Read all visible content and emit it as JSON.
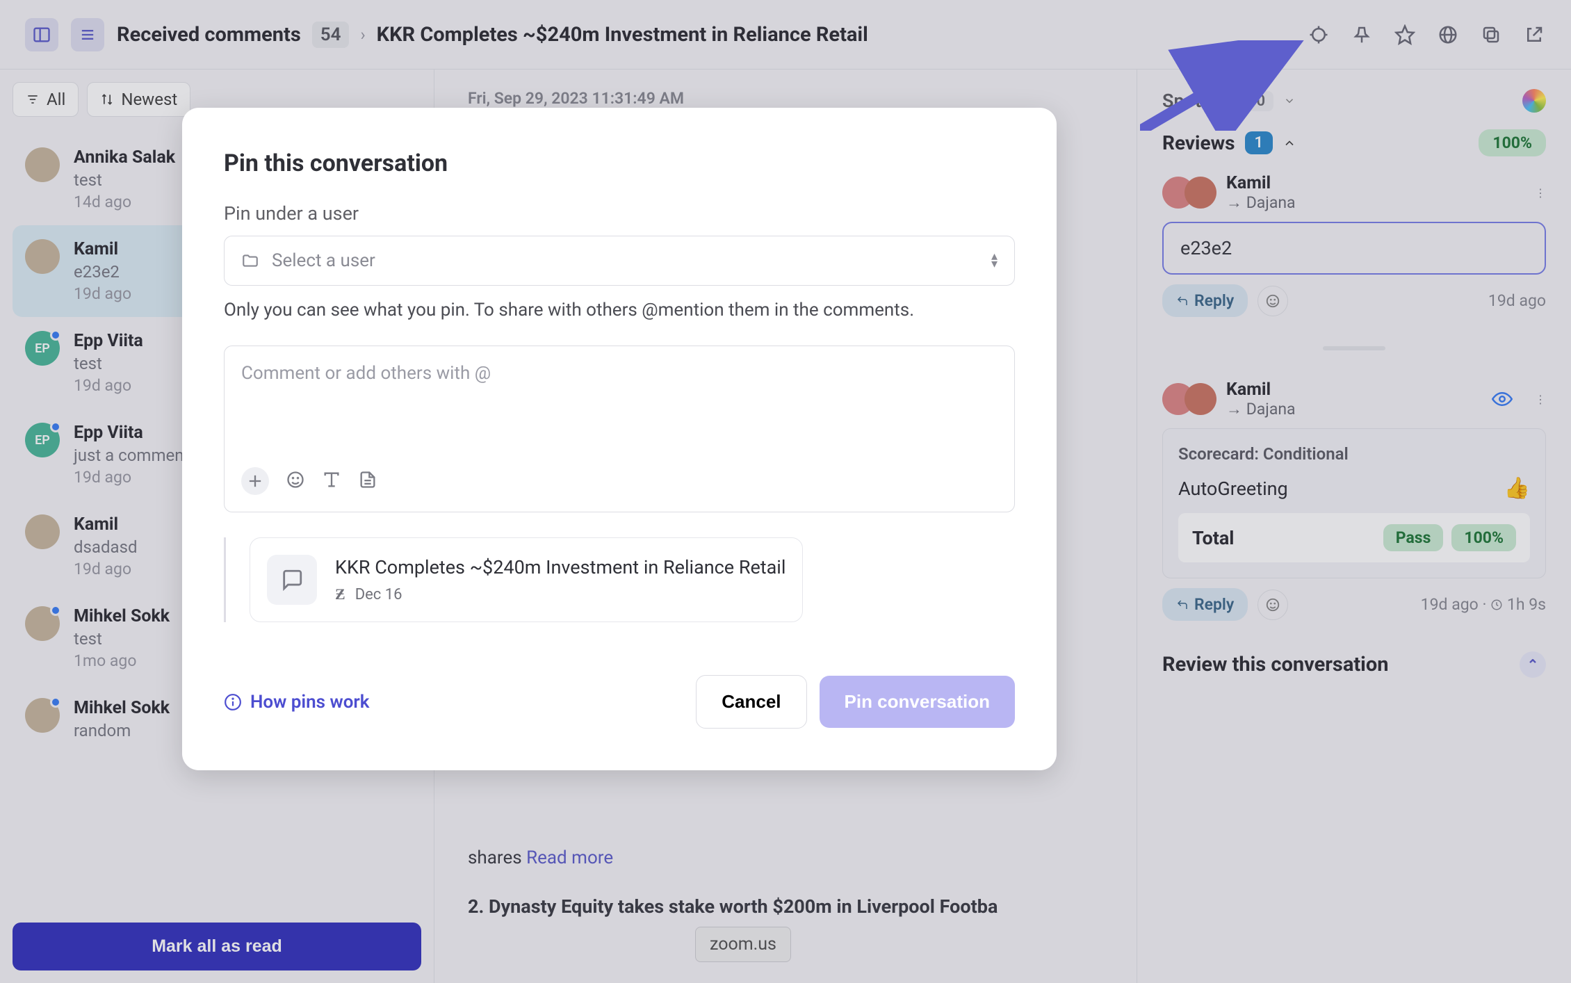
{
  "header": {
    "crumb_label": "Received comments",
    "crumb_count": "54",
    "title": "KKR Completes ~$240m Investment in Reliance Retail"
  },
  "filters": {
    "all": "All",
    "sort": "Newest"
  },
  "conversations": [
    {
      "name": "Annika Salak",
      "snippet": "test",
      "time": "14d ago",
      "avatar": "photo",
      "dot": false
    },
    {
      "name": "Kamil",
      "snippet": "e23e2",
      "time": "19d ago",
      "avatar": "photo",
      "dot": false,
      "active": true
    },
    {
      "name": "Epp Viita",
      "snippet": "test",
      "time": "19d ago",
      "avatar": "ep",
      "dot": true
    },
    {
      "name": "Epp Viita",
      "snippet": "just a commen",
      "time": "19d ago",
      "avatar": "ep",
      "dot": true
    },
    {
      "name": "Kamil",
      "snippet": "dsadasd",
      "time": "19d ago",
      "avatar": "photo",
      "dot": false
    },
    {
      "name": "Mihkel Sokk",
      "snippet": "test",
      "time": "1mo ago",
      "avatar": "photo",
      "dot": true
    },
    {
      "name": "Mihkel Sokk",
      "snippet": "random",
      "time": "",
      "avatar": "photo",
      "dot": true
    }
  ],
  "mark_read": "Mark all as read",
  "mid": {
    "timestamp": "Fri, Sep 29, 2023 11:31:49 AM",
    "read_more_word": "Read more",
    "headline": "2. Dynasty Equity takes stake worth $200m in Liverpool Footba",
    "subtext": ""
  },
  "right": {
    "spotlight_label": "Spotlight",
    "spotlight_count": "0",
    "reviews_label": "Reviews",
    "reviews_count": "1",
    "reviews_pct": "100%",
    "reviewer1": {
      "from": "Kamil",
      "to": "→ Dajana",
      "body": "e23e2",
      "time": "19d ago"
    },
    "reply_label": "Reply",
    "reviewer2": {
      "from": "Kamil",
      "to": "→ Dajana"
    },
    "scorecard": {
      "label": "Scorecard: Conditional",
      "row": "AutoGreeting",
      "thumb": "👍",
      "total": "Total",
      "pass": "Pass",
      "pct": "100%"
    },
    "meta_time": "19d ago",
    "meta_dur": "1h 9s",
    "review_this": "Review this conversation"
  },
  "modal": {
    "title": "Pin this conversation",
    "pin_under": "Pin under a user",
    "select_placeholder": "Select a user",
    "note": "Only you can see what you pin. To share with others @mention them in the comments.",
    "comment_placeholder": "Comment or add others with @",
    "card_title": "KKR Completes ~$240m Investment in Reliance Retail",
    "card_date": "Dec 16",
    "how": "How pins work",
    "cancel": "Cancel",
    "confirm": "Pin conversation"
  },
  "zoom_tip": "zoom.us"
}
